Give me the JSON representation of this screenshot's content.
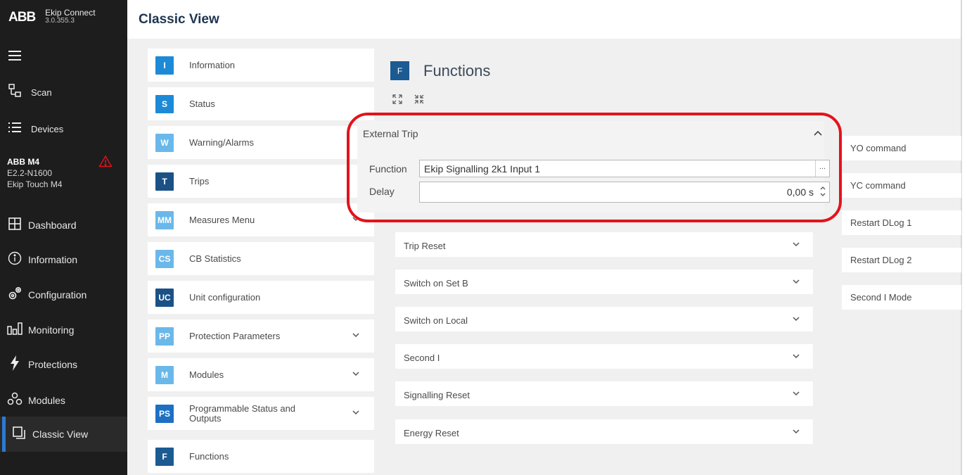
{
  "app": {
    "brand": "ABB",
    "name": "Ekip Connect",
    "version": "3.0.355.3"
  },
  "sidebar": {
    "menu_icon": "hamburger-icon",
    "scan": "Scan",
    "devices": "Devices",
    "device": {
      "name": "ABB M4",
      "model": "E2.2-N1600",
      "trip_unit": "Ekip Touch M4",
      "alert_icon": "warning-triangle-icon",
      "alert_color": "#e3131b"
    },
    "items": [
      {
        "label": "Dashboard",
        "icon": "grid-icon"
      },
      {
        "label": "Information",
        "icon": "info-circle-icon"
      },
      {
        "label": "Configuration",
        "icon": "gears-icon"
      },
      {
        "label": "Monitoring",
        "icon": "bars-icon"
      },
      {
        "label": "Protections",
        "icon": "lightning-icon"
      },
      {
        "label": "Modules",
        "icon": "modules-icon"
      },
      {
        "label": "Classic View",
        "icon": "classic-view-icon",
        "active": true
      }
    ],
    "active_color": "#2b7bd3"
  },
  "header": {
    "title": "Classic View"
  },
  "menu": [
    {
      "badge": "I",
      "label": "Information",
      "color": "#1d8ad8"
    },
    {
      "badge": "S",
      "label": "Status",
      "color": "#1d8ad8"
    },
    {
      "badge": "W",
      "label": "Warning/Alarms",
      "color": "#6ab8ea"
    },
    {
      "badge": "T",
      "label": "Trips",
      "color": "#1b5186"
    },
    {
      "badge": "MM",
      "label": "Measures Menu",
      "color": "#6ab8ea",
      "expandable": true
    },
    {
      "badge": "CS",
      "label": "CB Statistics",
      "color": "#6ab8ea"
    },
    {
      "badge": "UC",
      "label": "Unit configuration",
      "color": "#1b5186"
    },
    {
      "badge": "PP",
      "label": "Protection Parameters",
      "color": "#6ab8ea",
      "expandable": true
    },
    {
      "badge": "M",
      "label": "Modules",
      "color": "#6ab8ea",
      "expandable": true
    },
    {
      "badge": "PS",
      "label": "Programmable Status and Outputs",
      "color": "#1d6fc4",
      "expandable": true
    },
    {
      "badge": "F",
      "label": "Functions",
      "color": "#1c5a92"
    }
  ],
  "functions": {
    "badge": "F",
    "title": "Functions",
    "expand_all_icon": "expand-all-icon",
    "collapse_all_icon": "collapse-all-icon",
    "external_trip": {
      "title": "External Trip",
      "function_label": "Function",
      "function_value": "Ekip Signalling 2k1 Input 1",
      "dots": "...",
      "delay_label": "Delay",
      "delay_value": "0,00 s"
    },
    "accordion": [
      "Trip Reset",
      "Switch on Set B",
      "Switch on Local",
      "Second I",
      "Signalling Reset",
      "Energy Reset"
    ],
    "commands": [
      "YO command",
      "YC command",
      "Restart DLog 1",
      "Restart DLog 2",
      "Second I Mode"
    ],
    "highlight_color": "#e3131b"
  }
}
